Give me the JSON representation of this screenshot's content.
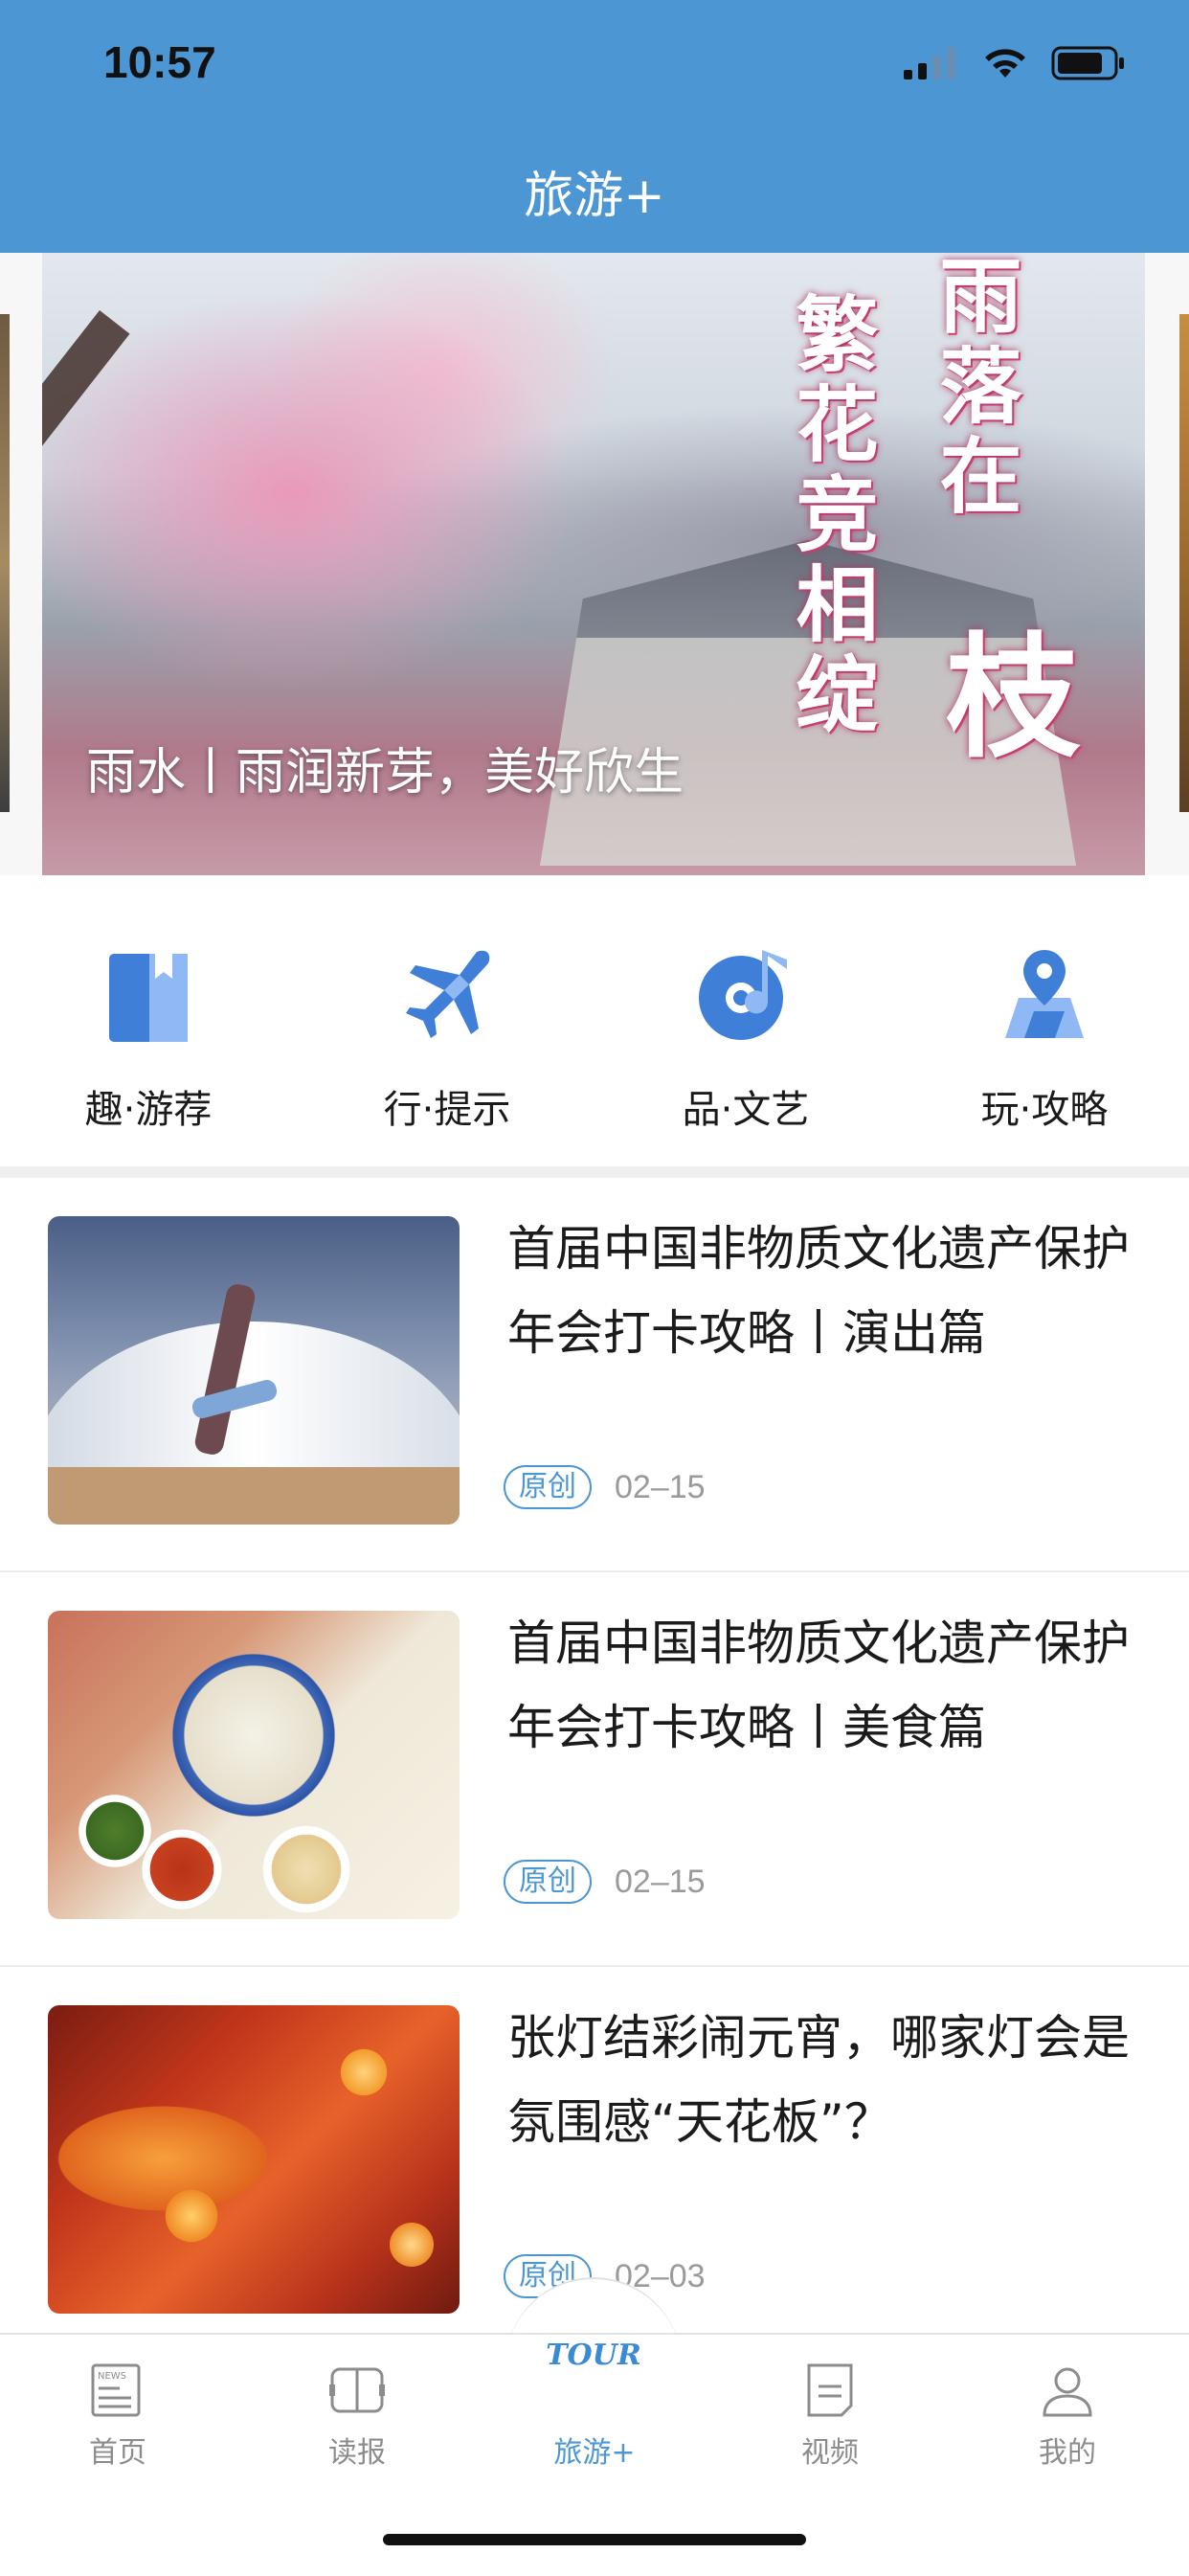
{
  "status_bar": {
    "time": "10:57",
    "icons": [
      "cellular-signal-icon",
      "wifi-icon",
      "battery-icon"
    ]
  },
  "header": {
    "title": "旅游+"
  },
  "banner": {
    "caption": "雨水丨雨润新芽，美好欣生",
    "overlay_text": [
      "繁花竞相绽",
      "雨落在",
      "枝"
    ]
  },
  "quick_menu": [
    {
      "label": "趣·游荐",
      "icon": "book-icon"
    },
    {
      "label": "行·提示",
      "icon": "airplane-icon"
    },
    {
      "label": "品·文艺",
      "icon": "music-disc-icon"
    },
    {
      "label": "玩·攻略",
      "icon": "map-location-icon"
    }
  ],
  "articles": [
    {
      "title": "首届中国非物质文化遗产保护年会打卡攻略丨演出篇",
      "badge": "原创",
      "date": "02–15"
    },
    {
      "title": "首届中国非物质文化遗产保护年会打卡攻略丨美食篇",
      "badge": "原创",
      "date": "02–15"
    },
    {
      "title": "张灯结彩闹元宵，哪家灯会是氛围感“天花板”？",
      "badge": "原创",
      "date": "02–03"
    }
  ],
  "tabbar": {
    "tabs": [
      {
        "label": "首页",
        "icon": "news-icon"
      },
      {
        "label": "读报",
        "icon": "newspaper-icon"
      },
      {
        "label": "旅游+",
        "icon": "tour-logo-icon",
        "logo_text": "TOUR"
      },
      {
        "label": "视频",
        "icon": "video-doc-icon"
      },
      {
        "label": "我的",
        "icon": "user-icon"
      }
    ],
    "active_index": 2
  },
  "colors": {
    "brand": "#4c97d3",
    "icon_blue": "#3f7fd8",
    "icon_light": "#8fb8f4"
  }
}
